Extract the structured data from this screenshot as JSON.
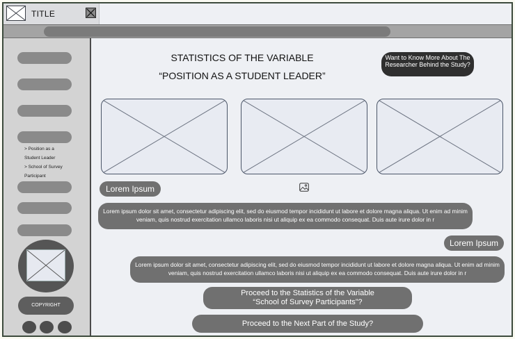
{
  "window": {
    "tab_title": "TITLE"
  },
  "sidebar": {
    "sub_items": [
      "> Position as a",
      "Student Leader",
      "> School of Survey",
      "Participant"
    ],
    "copyright": "COPYRIGHT"
  },
  "main": {
    "title_line1": "STATISTICS OF THE VARIABLE",
    "title_line2": "“POSITION AS A STUDENT LEADER”",
    "researcher_button": "Want to Know More About The Researcher Behind the Study?",
    "lorem_tag_1": "Lorem Ipsum",
    "lorem_tag_2": "Lorem Ipsum",
    "paragraph_1": "Lorem ipsum dolor sit amet, consectetur adipiscing elit, sed do eiusmod tempor incididunt ut labore et dolore magna aliqua. Ut enim ad minim veniam, quis nostrud exercitation ullamco laboris nisi ut aliquip ex ea commodo consequat. Duis aute irure dolor in r",
    "paragraph_2": "Lorem ipsum dolor sit amet, consectetur adipiscing elit, sed do eiusmod tempor incididunt ut labore et dolore magna aliqua. Ut enim ad minim veniam, quis nostrud exercitation ullamco laboris nisi ut aliquip ex ea commodo consequat. Duis aute irure dolor in r",
    "proceed_statistics_line1": "Proceed to the Statistics of the Variable",
    "proceed_statistics_line2": "“School of Survey Participants”?",
    "proceed_next": "Proceed to the Next Part of the Study?"
  }
}
